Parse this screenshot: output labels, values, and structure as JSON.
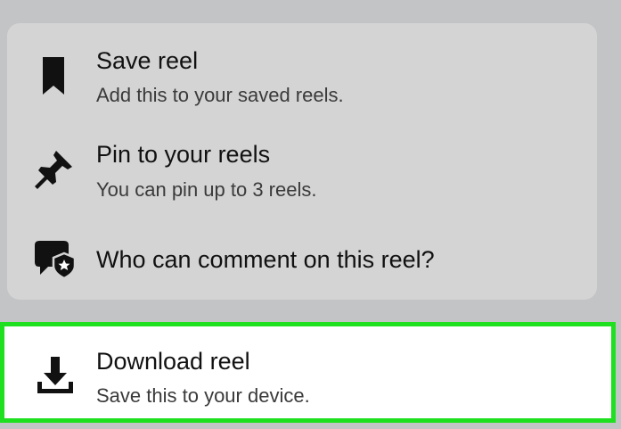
{
  "menu": {
    "items": [
      {
        "icon": "bookmark-icon",
        "title": "Save reel",
        "subtitle": "Add this to your saved reels."
      },
      {
        "icon": "pin-icon",
        "title": "Pin to your reels",
        "subtitle": "You can pin up to 3 reels."
      },
      {
        "icon": "comment-shield-icon",
        "title": "Who can comment on this reel?"
      }
    ]
  },
  "download": {
    "icon": "download-icon",
    "title": "Download reel",
    "subtitle": "Save this to your device.",
    "highlight_color": "#1fe01f"
  }
}
